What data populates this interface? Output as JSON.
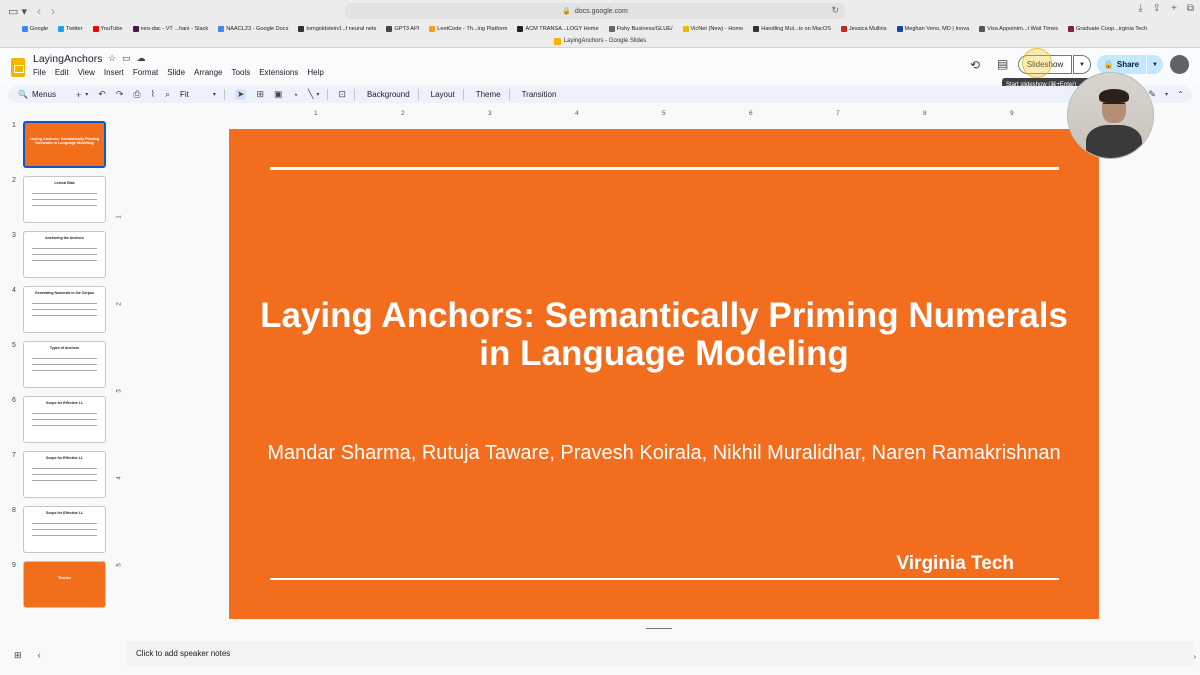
{
  "browser": {
    "url": "docs.google.com",
    "tab_title": "LayingAnchors - Google Slides",
    "bookmarks": [
      {
        "label": "Google",
        "color": "#4285f4"
      },
      {
        "label": "Twitter",
        "color": "#1da1f2"
      },
      {
        "label": "YouTube",
        "color": "#ff0000"
      },
      {
        "label": "neo-dac - VT ...hani - Slack",
        "color": "#4a154b"
      },
      {
        "label": "NAACL23 - Google Docs",
        "color": "#4285f4"
      },
      {
        "label": "tomgoldstein/l...f neural nets",
        "color": "#333333"
      },
      {
        "label": "GPT3 API",
        "color": "#444444"
      },
      {
        "label": "LeetCode - Th...ing Platform",
        "color": "#f89f1b"
      },
      {
        "label": "ACM TRANSA...LOGY Home",
        "color": "#222222"
      },
      {
        "label": "Fishy Business/GLUE/",
        "color": "#666666"
      },
      {
        "label": "VicNet (New) - Home",
        "color": "#f4b400"
      },
      {
        "label": "Handling Mul...ts on MacOS",
        "color": "#333333"
      },
      {
        "label": "Jessica Mullins",
        "color": "#c62828"
      },
      {
        "label": "Meghan Veno, MD | Inova",
        "color": "#0d47a1"
      },
      {
        "label": "Visa Appointm...t Wait Times",
        "color": "#555555"
      },
      {
        "label": "Graduate Coop...irginia Tech",
        "color": "#861f41"
      }
    ]
  },
  "header": {
    "doc_title": "LayingAnchors",
    "menus": [
      "File",
      "Edit",
      "View",
      "Insert",
      "Format",
      "Slide",
      "Arrange",
      "Tools",
      "Extensions",
      "Help"
    ],
    "slideshow_label": "Slideshow",
    "share_label": "Share",
    "tooltip": "Start slideshow (⌘+Enter)"
  },
  "toolbar": {
    "menus_label": "Menus",
    "zoom_label": "Fit",
    "background_label": "Background",
    "layout_label": "Layout",
    "theme_label": "Theme",
    "transition_label": "Transition"
  },
  "ruler": {
    "h_marks": [
      "1",
      "2",
      "3",
      "4",
      "5",
      "6",
      "7",
      "8",
      "9"
    ],
    "v_marks": [
      "1",
      "2",
      "3",
      "4",
      "5"
    ]
  },
  "filmstrip": {
    "thumbnails": [
      {
        "num": "1",
        "title": "Laying Anchors: Semantically Priming Numerals in Language Modeling",
        "style": "orange",
        "selected": true
      },
      {
        "num": "2",
        "title": "Lexical Bias",
        "style": "white",
        "selected": false
      },
      {
        "num": "3",
        "title": "Anchoring the Anchors",
        "style": "white",
        "selected": false
      },
      {
        "num": "4",
        "title": "Generating Numerals in the Corpus",
        "style": "white",
        "selected": false
      },
      {
        "num": "5",
        "title": "Types of Anchors",
        "style": "white",
        "selected": false
      },
      {
        "num": "6",
        "title": "Scope for Effective LL",
        "style": "white",
        "selected": false
      },
      {
        "num": "7",
        "title": "Scope for Effective LL",
        "style": "white",
        "selected": false
      },
      {
        "num": "8",
        "title": "Scope for Effective LL",
        "style": "white",
        "selected": false
      },
      {
        "num": "9",
        "title": "Thanks",
        "style": "orange",
        "selected": false
      }
    ]
  },
  "slide": {
    "title_line1": "Laying Anchors: Semantically Priming Numerals",
    "title_line2": "in Language Modeling",
    "authors": "Mandar Sharma, Rutuja Taware,  Pravesh Koirala, Nikhil Muralidhar, Naren Ramakrishnan",
    "affiliation": "Virginia Tech",
    "background_color": "#f26e1e"
  },
  "notes": {
    "placeholder": "Click to add speaker notes"
  }
}
